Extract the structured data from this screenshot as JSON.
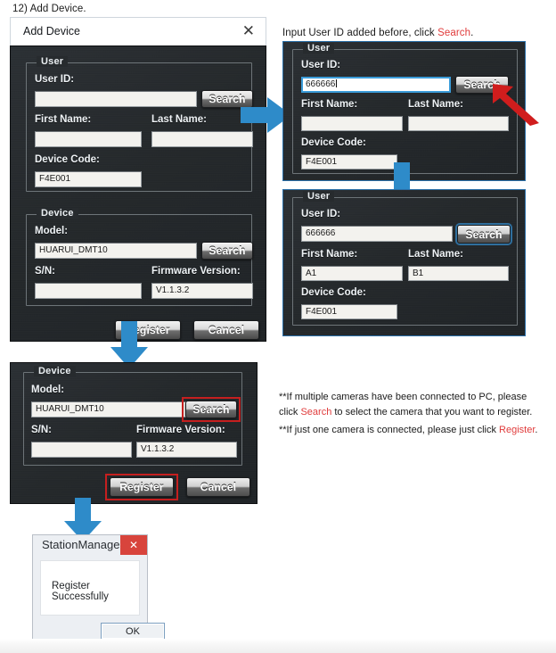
{
  "page": {
    "step_caption": "12) Add Device.",
    "right_caption_prefix": "Input User ID added before, click ",
    "right_caption_link": "Search",
    "right_caption_suffix": "."
  },
  "dialog1": {
    "title": "Add Device",
    "close_icon": "✕",
    "user_group": {
      "legend": "User",
      "user_id_label": "User ID:",
      "user_id_value": "",
      "search_button": "Search",
      "first_name_label": "First Name:",
      "first_name_value": "",
      "last_name_label": "Last Name:",
      "last_name_value": "",
      "device_code_label": "Device Code:",
      "device_code_value": "F4E001"
    },
    "device_group": {
      "legend": "Device",
      "model_label": "Model:",
      "model_value": "HUARUI_DMT10",
      "search_button": "Search",
      "sn_label": "S/N:",
      "sn_value": "",
      "firmware_label": "Firmware Version:",
      "firmware_value": "V1.1.3.2"
    },
    "register_button": "Register",
    "cancel_button": "Cancel"
  },
  "dialog2": {
    "legend": "User",
    "user_id_label": "User ID:",
    "user_id_value": "666666",
    "search_button": "Search",
    "first_name_label": "First Name:",
    "first_name_value": "",
    "last_name_label": "Last Name:",
    "last_name_value": "",
    "device_code_label": "Device Code:",
    "device_code_value": "F4E001"
  },
  "dialog3": {
    "legend": "User",
    "user_id_label": "User ID:",
    "user_id_value": "666666",
    "search_button": "Search",
    "first_name_label": "First Name:",
    "first_name_value": "A1",
    "last_name_label": "Last Name:",
    "last_name_value": "B1",
    "device_code_label": "Device Code:",
    "device_code_value": "F4E001"
  },
  "dialog4": {
    "legend": "Device",
    "model_label": "Model:",
    "model_value": "HUARUI_DMT10",
    "search_button": "Search",
    "sn_label": "S/N:",
    "sn_value": "",
    "firmware_label": "Firmware Version:",
    "firmware_value": "V1.1.3.2",
    "register_button": "Register",
    "cancel_button": "Cancel"
  },
  "notes": {
    "note1_a": "**If multiple cameras have been connected to PC, please",
    "note1_b": "click ",
    "note1_link": "Search",
    "note1_c": " to select the camera that you want to register.",
    "note2_a": "**If just one camera is connected, please just click ",
    "note2_link": "Register",
    "note2_b": "."
  },
  "station_manager": {
    "title": "StationManager",
    "close_label": "✕",
    "message": "Register Successfully",
    "ok_button": "OK"
  },
  "colors": {
    "accent_arrow": "#2e8bc9",
    "highlight": "#c51f1f",
    "link_red": "#e03b3b",
    "panel_dark": "#272b2e"
  }
}
